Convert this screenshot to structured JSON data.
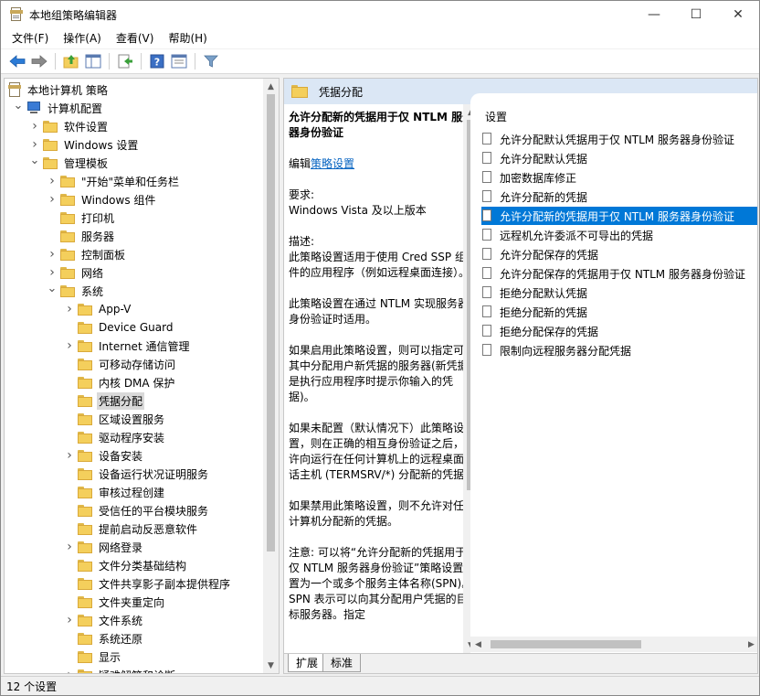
{
  "window": {
    "title": "本地组策略编辑器",
    "minimize": "—",
    "maximize": "☐",
    "close": "✕"
  },
  "menu": [
    "文件(F)",
    "操作(A)",
    "查看(V)",
    "帮助(H)"
  ],
  "toolbar": {
    "icons": [
      "back-arrow-icon",
      "forward-arrow-icon",
      "up-folder-icon",
      "show-hide-tree-icon",
      "export-list-icon",
      "help-icon",
      "properties-icon",
      "filter-icon"
    ]
  },
  "tree": {
    "rows": [
      {
        "label": "本地计算机 策略",
        "depth": 0,
        "arrow": "",
        "icon": "policy"
      },
      {
        "label": "计算机配置",
        "depth": 1,
        "arrow": "expanded",
        "icon": "computer"
      },
      {
        "label": "软件设置",
        "depth": 2,
        "arrow": "collapsed",
        "icon": "folder"
      },
      {
        "label": "Windows 设置",
        "depth": 2,
        "arrow": "collapsed",
        "icon": "folder"
      },
      {
        "label": "管理模板",
        "depth": 2,
        "arrow": "expanded",
        "icon": "folder"
      },
      {
        "label": "\"开始\"菜单和任务栏",
        "depth": 3,
        "arrow": "collapsed",
        "icon": "folder"
      },
      {
        "label": "Windows 组件",
        "depth": 3,
        "arrow": "collapsed",
        "icon": "folder"
      },
      {
        "label": "打印机",
        "depth": 3,
        "arrow": "",
        "icon": "folder"
      },
      {
        "label": "服务器",
        "depth": 3,
        "arrow": "",
        "icon": "folder"
      },
      {
        "label": "控制面板",
        "depth": 3,
        "arrow": "collapsed",
        "icon": "folder"
      },
      {
        "label": "网络",
        "depth": 3,
        "arrow": "collapsed",
        "icon": "folder"
      },
      {
        "label": "系统",
        "depth": 3,
        "arrow": "expanded",
        "icon": "folder"
      },
      {
        "label": "App-V",
        "depth": 4,
        "arrow": "collapsed",
        "icon": "folder"
      },
      {
        "label": "Device Guard",
        "depth": 4,
        "arrow": "",
        "icon": "folder"
      },
      {
        "label": "Internet 通信管理",
        "depth": 4,
        "arrow": "collapsed",
        "icon": "folder"
      },
      {
        "label": "可移动存储访问",
        "depth": 4,
        "arrow": "",
        "icon": "folder"
      },
      {
        "label": "内核 DMA 保护",
        "depth": 4,
        "arrow": "",
        "icon": "folder"
      },
      {
        "label": "凭据分配",
        "depth": 4,
        "arrow": "",
        "icon": "folder",
        "selected": true
      },
      {
        "label": "区域设置服务",
        "depth": 4,
        "arrow": "",
        "icon": "folder"
      },
      {
        "label": "驱动程序安装",
        "depth": 4,
        "arrow": "",
        "icon": "folder"
      },
      {
        "label": "设备安装",
        "depth": 4,
        "arrow": "collapsed",
        "icon": "folder"
      },
      {
        "label": "设备运行状况证明服务",
        "depth": 4,
        "arrow": "",
        "icon": "folder"
      },
      {
        "label": "审核过程创建",
        "depth": 4,
        "arrow": "",
        "icon": "folder"
      },
      {
        "label": "受信任的平台模块服务",
        "depth": 4,
        "arrow": "",
        "icon": "folder"
      },
      {
        "label": "提前启动反恶意软件",
        "depth": 4,
        "arrow": "",
        "icon": "folder"
      },
      {
        "label": "网络登录",
        "depth": 4,
        "arrow": "collapsed",
        "icon": "folder"
      },
      {
        "label": "文件分类基础结构",
        "depth": 4,
        "arrow": "",
        "icon": "folder"
      },
      {
        "label": "文件共享影子副本提供程序",
        "depth": 4,
        "arrow": "",
        "icon": "folder"
      },
      {
        "label": "文件夹重定向",
        "depth": 4,
        "arrow": "",
        "icon": "folder"
      },
      {
        "label": "文件系统",
        "depth": 4,
        "arrow": "collapsed",
        "icon": "folder"
      },
      {
        "label": "系统还原",
        "depth": 4,
        "arrow": "",
        "icon": "folder"
      },
      {
        "label": "显示",
        "depth": 4,
        "arrow": "",
        "icon": "folder"
      },
      {
        "label": "疑难解答和诊断",
        "depth": 4,
        "arrow": "collapsed",
        "icon": "folder"
      }
    ]
  },
  "right": {
    "header_title": "凭据分配",
    "description": {
      "title": "允许分配新的凭据用于仅 NTLM 服务器身份验证",
      "edit_prefix": "编辑",
      "edit_link": "策略设置",
      "req_label": "要求:",
      "req_value": "Windows Vista 及以上版本",
      "desc_label": "描述:",
      "p1": "此策略设置适用于使用 Cred SSP 组件的应用程序（例如远程桌面连接）。",
      "p2": "此策略设置在通过 NTLM 实现服务器身份验证时适用。",
      "p3": "如果启用此策略设置，则可以指定可向其中分配用户新凭据的服务器(新凭据是执行应用程序时提示你输入的凭据)。",
      "p4": "如果未配置（默认情况下）此策略设置，则在正确的相互身份验证之后，允许向运行在任何计算机上的远程桌面会话主机 (TERMSRV/*) 分配新的凭据。",
      "p5": "如果禁用此策略设置，则不允许对任何计算机分配新的凭据。",
      "p6": "注意: 可以将“允许分配新的凭据用于仅 NTLM 服务器身份验证”策略设置设置为一个或多个服务主体名称(SPN)。SPN 表示可以向其分配用户凭据的目标服务器。指定"
    },
    "list_header": "设置",
    "settings": [
      "允许分配默认凭据用于仅 NTLM 服务器身份验证",
      "允许分配默认凭据",
      "加密数据库修正",
      "允许分配新的凭据",
      "允许分配新的凭据用于仅 NTLM 服务器身份验证",
      "远程机允许委派不可导出的凭据",
      "允许分配保存的凭据",
      "允许分配保存的凭据用于仅 NTLM 服务器身份验证",
      "拒绝分配默认凭据",
      "拒绝分配新的凭据",
      "拒绝分配保存的凭据",
      "限制向远程服务器分配凭据"
    ],
    "selected_index": 4,
    "tabs": [
      "扩展",
      "标准"
    ]
  },
  "status": "12 个设置",
  "colors": {
    "selection": "#0078d7",
    "header_bg": "#dbe7f5",
    "link": "#0563c1"
  }
}
